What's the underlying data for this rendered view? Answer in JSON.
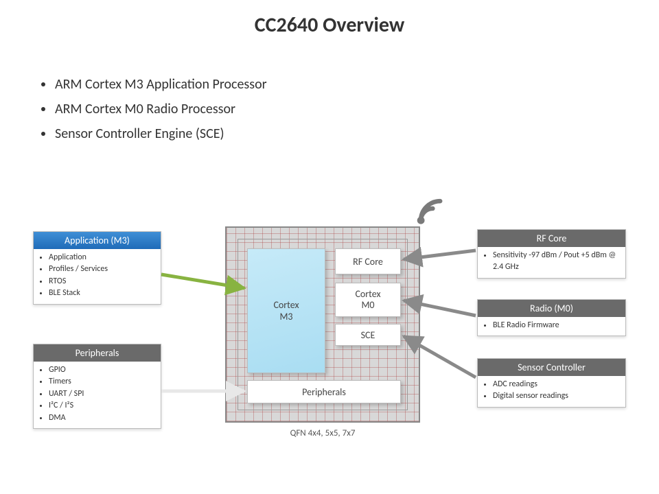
{
  "title": "CC2640 Overview",
  "top_bullets": [
    "ARM Cortex M3 Application Processor",
    "ARM Cortex M0 Radio Processor",
    "Sensor Controller Engine (SCE)"
  ],
  "cards": {
    "app_m3": {
      "header": "Application (M3)",
      "items": [
        "Application",
        "Profiles / Services",
        "RTOS",
        "BLE Stack"
      ]
    },
    "peripherals": {
      "header": "Peripherals",
      "items": [
        "GPIO",
        "Timers",
        "UART / SPI",
        "I²C / I²S",
        "DMA"
      ]
    },
    "rf_core": {
      "header": "RF Core",
      "items": [
        "Sensitivity -97 dBm / Pout +5 dBm @ 2.4 GHz"
      ]
    },
    "radio_m0": {
      "header": "Radio (M0)",
      "items": [
        "BLE Radio Firmware"
      ]
    },
    "sensor_ctrl": {
      "header": "Sensor Controller",
      "items": [
        "ADC readings",
        "Digital sensor readings"
      ]
    }
  },
  "chip": {
    "blocks": {
      "cortex_m3": "Cortex\nM3",
      "rf_core": "RF Core",
      "cortex_m0": "Cortex\nM0",
      "sce": "SCE",
      "peripherals": "Peripherals"
    },
    "caption": "QFN 4x4, 5x5, 7x7"
  },
  "icons": {
    "wifi": "wifi-icon"
  },
  "connections": [
    {
      "from": "app_m3",
      "to": "cortex_m3",
      "color": "#88b341"
    },
    {
      "from": "peripherals",
      "to": "peripherals",
      "color": "#e8e8e8"
    },
    {
      "from": "rf_core",
      "to": "rf_core",
      "color": "#8a8a8a"
    },
    {
      "from": "radio_m0",
      "to": "cortex_m0",
      "color": "#8a8a8a"
    },
    {
      "from": "sensor_ctrl",
      "to": "sce",
      "color": "#8a8a8a"
    }
  ]
}
